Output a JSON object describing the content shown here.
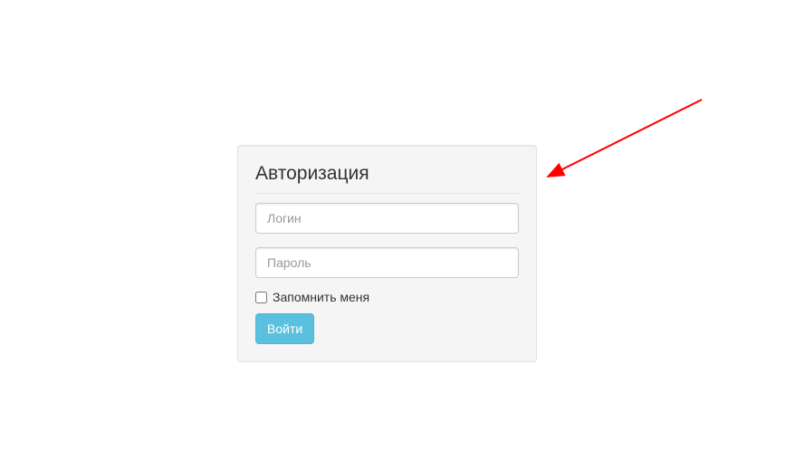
{
  "login": {
    "heading": "Авторизация",
    "username_placeholder": "Логин",
    "password_placeholder": "Пароль",
    "remember_label": "Запомнить меня",
    "submit_label": "Войти"
  }
}
